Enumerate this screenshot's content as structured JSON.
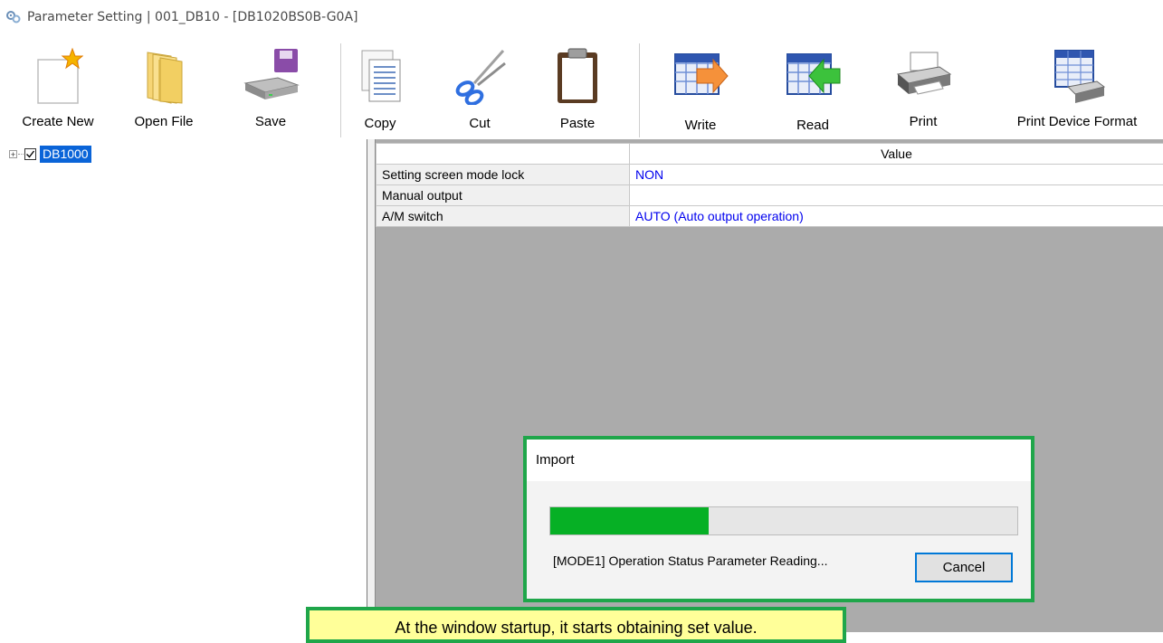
{
  "window": {
    "title": "Parameter Setting  | 001_DB10 - [DB1020BS0B-G0A]",
    "app_icon": "gear-cluster-icon"
  },
  "toolbar": {
    "buttons": [
      {
        "label": "Create New",
        "icon": "new-document-icon"
      },
      {
        "label": "Open File",
        "icon": "folder-icon"
      },
      {
        "label": "Save",
        "icon": "save-drive-icon"
      },
      {
        "label": "Copy",
        "icon": "copy-icon"
      },
      {
        "label": "Cut",
        "icon": "scissors-icon"
      },
      {
        "label": "Paste",
        "icon": "clipboard-icon"
      },
      {
        "label": "Write",
        "icon": "write-to-device-icon"
      },
      {
        "label": "Read",
        "icon": "read-from-device-icon"
      },
      {
        "label": "Print",
        "icon": "printer-icon"
      },
      {
        "label": "Print Device Format",
        "icon": "print-device-format-icon"
      }
    ]
  },
  "tree": {
    "root": {
      "label": "DB1000",
      "checked": true,
      "expanded": false,
      "selected": true
    }
  },
  "grid": {
    "headers": {
      "name": "",
      "value": "Value"
    },
    "rows": [
      {
        "name": "Setting screen mode lock",
        "value": "NON"
      },
      {
        "name": "Manual output",
        "value": ""
      },
      {
        "name": "A/M switch",
        "value": "AUTO (Auto output operation)"
      }
    ]
  },
  "dialog": {
    "title": "Import",
    "progress": 0.34,
    "message": "[MODE1] Operation Status Parameter Reading...",
    "cancel_label": "Cancel"
  },
  "callout": {
    "text": "At the window startup, it starts obtaining set value."
  },
  "colors": {
    "selection": "#0a64d8",
    "value_text": "#0000ee",
    "progress_fill": "#06b025",
    "callout_border": "#1fa64a",
    "callout_bg": "#ffff99"
  }
}
